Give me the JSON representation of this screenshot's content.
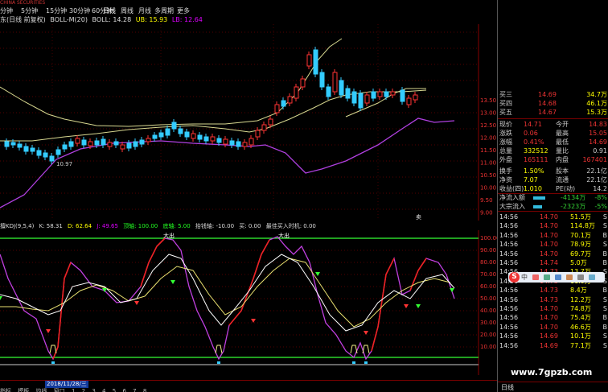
{
  "app": {
    "logo": "CHINA SECURITIES",
    "timeframes": [
      "分钟",
      "5分钟",
      "15分钟",
      "30分钟",
      "60分钟",
      "日线",
      "周线",
      "月线",
      "多周期",
      "更多"
    ],
    "weight_label": "东(日线 前复权)",
    "indicator": "BOLL-M(20)",
    "boll_label": "BOLL: 14.28",
    "ub_label": "UB: 15.93",
    "lb_label": "LB: 12.64",
    "low_price_label": "10.97",
    "buy_sell_tag": "卖"
  },
  "price_axis": {
    "ticks": [
      "13.50",
      "13.00",
      "12.50",
      "12.00",
      "11.50",
      "11.00",
      "10.50",
      "10.00",
      "9.50",
      "9.00"
    ]
  },
  "kdj": {
    "name": "擅KDJ(9,5,4)",
    "k": "K: 58.31",
    "d": "D: 62.64",
    "j": "J: 49.65",
    "top_line": "顶轴: 100.00",
    "bottom_line": "底轴: 5.00",
    "pick_line": "抬钱轴: -10.00",
    "buy": "买: 0.00",
    "best_buy": "最佳买入时机: 0.00",
    "ticks": [
      "100.00",
      "90.00",
      "80.00",
      "70.00",
      "60.00",
      "50.00",
      "40.00",
      "30.00",
      "20.00",
      "10.00"
    ],
    "labels": [
      "大出",
      "大出"
    ]
  },
  "datebar": {
    "date": "2018/11/28/三",
    "tabs": [
      "指标",
      "模板",
      "均线",
      "窗口",
      "1",
      "2",
      "3",
      "4",
      "5",
      "6",
      "7",
      "8"
    ],
    "right_tab": "日线"
  },
  "quote": {
    "asks": [
      {
        "label": "买三",
        "price": "14.69",
        "vol": "34.7万"
      },
      {
        "label": "买四",
        "price": "14.68",
        "vol": "46.1万"
      },
      {
        "label": "买五",
        "price": "14.67",
        "vol": "15.3万"
      }
    ],
    "stats": [
      {
        "l1": "现价",
        "v1": "14.71",
        "l2": "今开",
        "v2": "14.83"
      },
      {
        "l1": "涨跌",
        "v1": "0.06",
        "l2": "最高",
        "v2": "15.05"
      },
      {
        "l1": "涨幅",
        "v1": "0.41%",
        "l2": "最低",
        "v2": "14.69"
      },
      {
        "l1": "总量",
        "v1": "332512",
        "l2": "量比",
        "v2": "0.91"
      },
      {
        "l1": "外盘",
        "v1": "165111",
        "l2": "内盘",
        "v2": "167401"
      },
      {
        "l1": "换手",
        "v1": "1.50%",
        "l2": "股本",
        "v2": "22.1亿"
      },
      {
        "l1": "净资",
        "v1": "7.07",
        "l2": "流通",
        "v2": "22.1亿"
      },
      {
        "l1": "收益(四)",
        "v1": "1.010",
        "l2": "PE(动)",
        "v2": "14.2"
      }
    ],
    "flows": [
      {
        "label": "净流入额",
        "value": "-4134万",
        "pct": "-8%",
        "fill": 0.55
      },
      {
        "label": "大宗流入",
        "value": "-2323万",
        "pct": "-5%",
        "fill": 0.4
      }
    ],
    "ticks": [
      {
        "t": "14:56",
        "p": "14.70",
        "v": "51.5万",
        "d": "S"
      },
      {
        "t": "14:56",
        "p": "14.70",
        "v": "114.8万",
        "d": "S"
      },
      {
        "t": "14:56",
        "p": "14.70",
        "v": "70.1万",
        "d": "B"
      },
      {
        "t": "14:56",
        "p": "14.70",
        "v": "78.9万",
        "d": "S"
      },
      {
        "t": "14:56",
        "p": "14.70",
        "v": "69.7万",
        "d": "B"
      },
      {
        "t": "14:56",
        "p": "14.74",
        "v": "5.0万",
        "d": "B"
      },
      {
        "t": "14:56",
        "p": "14.73",
        "v": "13.7万",
        "d": "S"
      },
      {
        "t": "14:56",
        "p": "14.73",
        "v": "11.9万",
        "d": "S"
      },
      {
        "t": "14:56",
        "p": "14.73",
        "v": "8.4万",
        "d": "B"
      },
      {
        "t": "14:56",
        "p": "14.73",
        "v": "12.2万",
        "d": "S"
      },
      {
        "t": "14:56",
        "p": "14.70",
        "v": "74.8万",
        "d": "S"
      },
      {
        "t": "14:56",
        "p": "14.70",
        "v": "75.4万",
        "d": "B"
      },
      {
        "t": "14:56",
        "p": "14.70",
        "v": "46.6万",
        "d": "B"
      },
      {
        "t": "14:56",
        "p": "14.69",
        "v": "10.1万",
        "d": "S"
      },
      {
        "t": "14:56",
        "p": "14.69",
        "v": "77.1万",
        "d": "S"
      }
    ],
    "float_toolbar_label": "中"
  },
  "watermark": "www.7gpzb.com"
}
